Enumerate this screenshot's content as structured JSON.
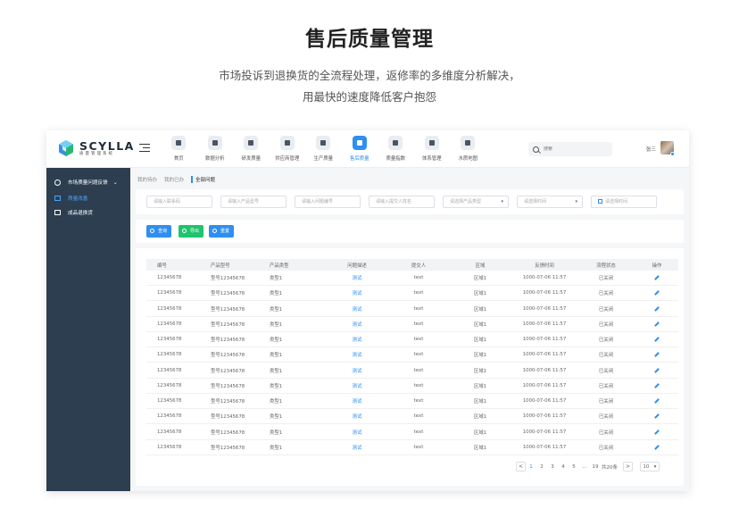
{
  "hero": {
    "title": "售后质量管理",
    "subtitle_line1": "市场投诉到退换货的全流程处理，返修率的多维度分析解决，",
    "subtitle_line2": "用最快的速度降低客户抱怨"
  },
  "logo": {
    "name": "SCYLLA",
    "tagline": "质量管理系统"
  },
  "nav": {
    "items": [
      {
        "label": "首页",
        "icon": "home-icon"
      },
      {
        "label": "数据分析",
        "icon": "analytics-icon"
      },
      {
        "label": "研发质量",
        "icon": "rd-icon"
      },
      {
        "label": "供应商管理",
        "icon": "supplier-icon"
      },
      {
        "label": "生产质量",
        "icon": "production-icon"
      },
      {
        "label": "售后质量",
        "icon": "aftersales-icon"
      },
      {
        "label": "质量指数",
        "icon": "index-icon"
      },
      {
        "label": "体系管理",
        "icon": "system-icon"
      },
      {
        "label": "水质地图",
        "icon": "map-icon"
      }
    ],
    "active": "售后质量"
  },
  "search": {
    "placeholder": "搜索"
  },
  "user": {
    "name": "张三"
  },
  "sidebar": {
    "group": "市场质量问题反馈",
    "items": [
      {
        "label": "质量改善",
        "active": true
      },
      {
        "label": "成品退换货",
        "active": false
      }
    ]
  },
  "tabs": [
    "我的待办",
    "我的已办",
    "全部问题"
  ],
  "active_tab": "全部问题",
  "filters": {
    "contact_number": "请输入联系码",
    "product_model": "请输入产品型号",
    "issue_number": "请输入问题编号",
    "submitter_name": "请输入提交人姓名",
    "product_type": "请选择产品类型",
    "issue_date": "请选择时间",
    "feedback_date": "请选择时间"
  },
  "buttons": {
    "query": "查询",
    "export": "导出",
    "reset": "重置"
  },
  "table": {
    "headers": [
      "编号",
      "产品型号",
      "产品类型",
      "问题描述",
      "提交人",
      "区域",
      "反馈时间",
      "流程状态",
      "操作"
    ],
    "rows": [
      [
        "12345678",
        "型号12345678",
        "类型1",
        "测试",
        "text",
        "区域1",
        "1000-07-06 11:57",
        "已关闭"
      ],
      [
        "12345678",
        "型号12345678",
        "类型1",
        "测试",
        "text",
        "区域1",
        "1000-07-06 11:57",
        "已关闭"
      ],
      [
        "12345678",
        "型号12345678",
        "类型1",
        "测试",
        "text",
        "区域1",
        "1000-07-06 11:57",
        "已关闭"
      ],
      [
        "12345678",
        "型号12345678",
        "类型1",
        "测试",
        "text",
        "区域1",
        "1000-07-06 11:57",
        "已关闭"
      ],
      [
        "12345678",
        "型号12345678",
        "类型1",
        "测试",
        "text",
        "区域1",
        "1000-07-06 11:57",
        "已关闭"
      ],
      [
        "12345678",
        "型号12345678",
        "类型1",
        "测试",
        "text",
        "区域1",
        "1000-07-06 11:57",
        "已关闭"
      ],
      [
        "12345678",
        "型号12345678",
        "类型1",
        "测试",
        "text",
        "区域1",
        "1000-07-06 11:57",
        "已关闭"
      ],
      [
        "12345678",
        "型号12345678",
        "类型1",
        "测试",
        "text",
        "区域1",
        "1000-07-06 11:57",
        "已关闭"
      ],
      [
        "12345678",
        "型号12345678",
        "类型1",
        "测试",
        "text",
        "区域1",
        "1000-07-06 11:57",
        "已关闭"
      ],
      [
        "12345678",
        "型号12345678",
        "类型1",
        "测试",
        "text",
        "区域1",
        "1000-07-06 11:57",
        "已关闭"
      ],
      [
        "12345678",
        "型号12345678",
        "类型1",
        "测试",
        "text",
        "区域1",
        "1000-07-06 11:57",
        "已关闭"
      ],
      [
        "12345678",
        "型号12345678",
        "类型1",
        "测试",
        "text",
        "区域1",
        "1000-07-06 11:57",
        "已关闭"
      ]
    ],
    "action_icon": "edit-icon"
  },
  "pagination": {
    "prev": "<",
    "pages": [
      "1",
      "2",
      "3",
      "4",
      "5",
      "...",
      "19"
    ],
    "current": "1",
    "next": ">",
    "total": "共20条",
    "page_size": "10"
  },
  "colors": {
    "accent": "#2f8ff0",
    "sidebar": "#2c3e50",
    "export": "#1fc46e"
  }
}
